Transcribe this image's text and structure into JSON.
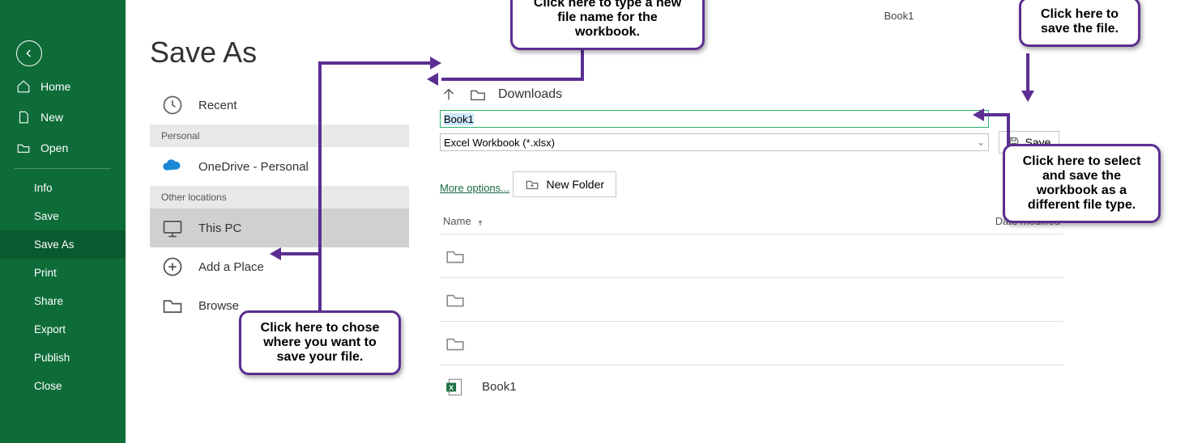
{
  "window_title": "Book1",
  "page_title": "Save As",
  "sidebar": {
    "home": "Home",
    "new": "New",
    "open": "Open",
    "info": "Info",
    "save": "Save",
    "save_as": "Save As",
    "print": "Print",
    "share": "Share",
    "export": "Export",
    "publish": "Publish",
    "close": "Close"
  },
  "locations": {
    "recent": "Recent",
    "section_personal": "Personal",
    "onedrive": "OneDrive - Personal",
    "section_other": "Other locations",
    "this_pc": "This PC",
    "add_place": "Add a Place",
    "browse": "Browse"
  },
  "panel": {
    "crumb": "Downloads",
    "filename_value": "Book1",
    "filetype_selected": "Excel Workbook (*.xlsx)",
    "more_options": "More options...",
    "save_label": "Save",
    "new_folder_label": "New Folder",
    "header_name": "Name",
    "header_modified": "Date modified",
    "rows": [
      {
        "type": "folder",
        "label": ""
      },
      {
        "type": "folder",
        "label": ""
      },
      {
        "type": "folder",
        "label": ""
      },
      {
        "type": "excel",
        "label": "Book1"
      }
    ]
  },
  "callouts": {
    "filename": "Click here to type a new file name for the workbook.",
    "save": "Click here to save the file.",
    "filetype": "Click here to select and save the workbook as a different file type.",
    "location": "Click here to chose where you want to save your file."
  }
}
